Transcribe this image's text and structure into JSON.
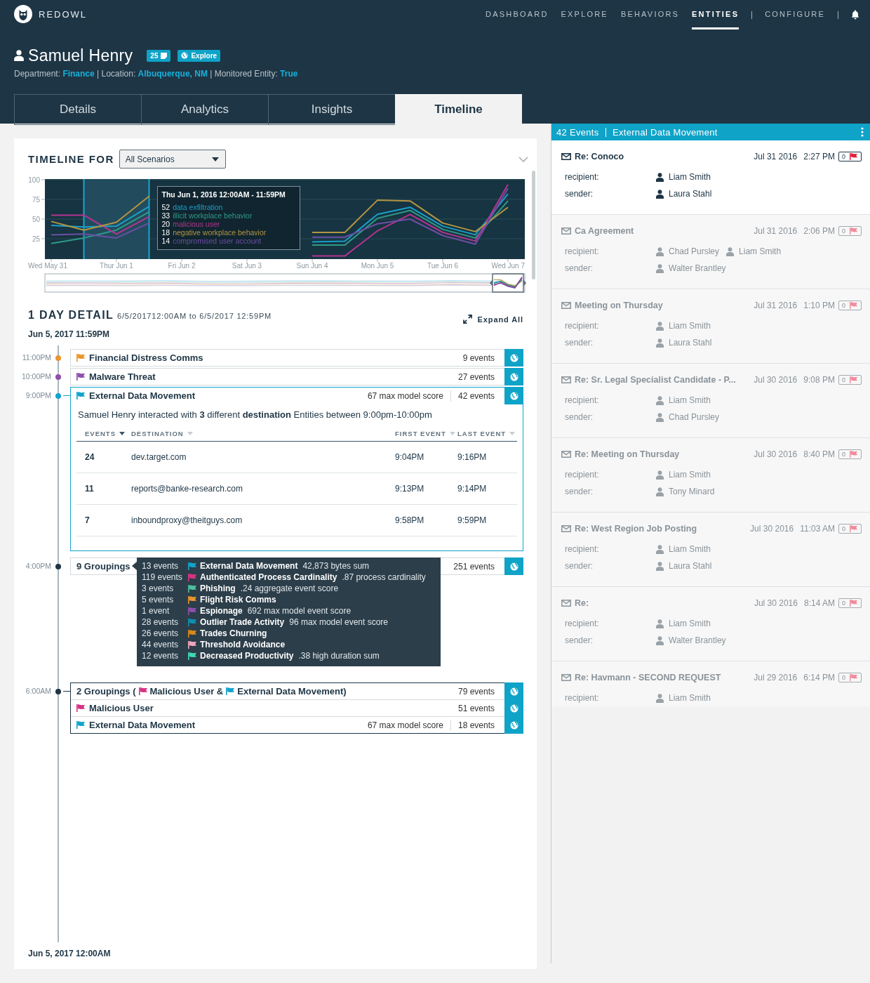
{
  "header": {
    "brand": "REDOWL",
    "nav_groups": [
      [
        {
          "label": "DASHBOARD",
          "selected": false
        },
        {
          "label": "EXPLORE",
          "selected": false
        },
        {
          "label": "BEHAVIORS",
          "selected": false
        },
        {
          "label": "ENTITIES",
          "selected": true
        }
      ],
      [
        {
          "label": "CONFIGURE",
          "selected": false
        }
      ]
    ]
  },
  "entity": {
    "name": "Samuel Henry",
    "notes_count": "25",
    "explore_label": "Explore",
    "meta": "Department: **Finance** | Location: **Albuquerque, NM** | Monitored Entity: **True**"
  },
  "tabs": [
    {
      "label": "Details",
      "selected": false
    },
    {
      "label": "Analytics",
      "selected": false
    },
    {
      "label": "Insights",
      "selected": false
    },
    {
      "label": "Timeline",
      "selected": true
    }
  ],
  "timeline": {
    "title": "TIMELINE FOR",
    "scenario": "All Scenarios",
    "days": [
      {
        "selected": false
      },
      {
        "selected": true
      },
      {
        "selected": false
      },
      {
        "selected": false
      },
      {
        "selected": false
      },
      {
        "selected": false
      },
      {
        "selected": false
      },
      {
        "selected": false
      }
    ],
    "chart_data": {
      "type": "line",
      "grid": true,
      "categories": [
        "Wed May 31",
        null,
        "Thur Jun 1",
        null,
        "Fri Jun 2",
        null,
        "Sat Jun 3",
        null,
        "Sun Jun 4",
        null,
        "Mon Jun 5",
        null,
        "Tue Jun 6",
        null,
        "Wed Jun 7"
      ],
      "ylim": [
        0,
        100
      ],
      "yticks": [
        25,
        50,
        75,
        100
      ],
      "series": [
        {
          "name": "data exfiltration",
          "color": "#1a9fca",
          "values": [
            42,
            40,
            41,
            66,
            null,
            null,
            null,
            null,
            21,
            22,
            56,
            65,
            41,
            30,
            82
          ]
        },
        {
          "name": "illicit workplace behavior",
          "color": "#2f9a8a",
          "values": [
            19,
            26,
            36,
            59,
            null,
            null,
            null,
            null,
            17,
            17,
            51,
            61,
            37,
            26,
            73
          ]
        },
        {
          "name": "malicious user",
          "color": "#b3348f",
          "values": [
            55,
            55,
            31,
            53,
            null,
            null,
            null,
            null,
            3,
            3,
            35,
            56,
            33,
            22,
            94
          ]
        },
        {
          "name": "negative workplace behavior",
          "color": "#b39543",
          "values": [
            47,
            36,
            46,
            79,
            null,
            null,
            null,
            null,
            33,
            33,
            74,
            73,
            45,
            34,
            65
          ]
        },
        {
          "name": "compromised user account",
          "color": "#6c4ea3",
          "values": [
            30,
            31,
            26,
            45,
            null,
            null,
            null,
            null,
            27,
            27,
            44,
            50,
            29,
            18,
            89
          ]
        }
      ]
    },
    "tooltip": {
      "title": "Thu Jun 1, 2016 12:00AM - 11:59PM",
      "values": [
        "52",
        "33",
        "20",
        "18",
        "14"
      ]
    }
  },
  "day_detail": {
    "title": "1 DAY DETAIL",
    "range": "6/5/201712:00AM to 6/5/2017 12:59PM",
    "expand_label": "Expand All",
    "start": "Jun 5, 2017 11:59PM",
    "end": "Jun 5, 2017 12:00AM",
    "entries": [
      {
        "kind": "scenario",
        "time": "11:00PM",
        "color": "#e8962e",
        "name": "Financial Distress Comms",
        "events": "9 events",
        "expanded": false
      },
      {
        "kind": "scenario",
        "time": "10:00PM",
        "color": "#8e4fae",
        "name": "Malware Threat",
        "events": "27 events",
        "expanded": false
      },
      {
        "kind": "scenario",
        "time": "9:00PM",
        "color": "#12a3cc",
        "name": "External Data Movement",
        "score": "67 max model score",
        "events": "42 events",
        "expanded": true,
        "detail": {
          "summary": "Samuel Henry interacted with **3** different **destination** Entities between 9:00pm-10:00pm",
          "columns": [
            {
              "label": "EVENTS",
              "sorted": true
            },
            {
              "label": "DESTINATION",
              "sorted": false
            },
            {
              "label": "FIRST EVENT",
              "sorted": false
            },
            {
              "label": "LAST EVENT",
              "sorted": false
            }
          ],
          "rows": [
            [
              "24",
              "dev.target.com",
              "9:04PM",
              "9:16PM"
            ],
            [
              "11",
              "reports@banke-research.com",
              "9:13PM",
              "9:14PM"
            ],
            [
              "7",
              "inboundproxy@theitguys.com",
              "9:58PM",
              "9:59PM"
            ]
          ]
        }
      },
      {
        "kind": "groupings",
        "time": "4:00PM",
        "color": "#1e3545",
        "name": "9 Groupings",
        "events": "251 events",
        "expanded": false,
        "popover": [
          {
            "events": "13 events",
            "color": "#12a3cc",
            "name": "External Data Movement",
            "metric": "42,873 bytes sum"
          },
          {
            "events": "119 events",
            "color": "#d63384",
            "name": "Authenticated Process Cardinality",
            "metric": ".87 process cardinality"
          },
          {
            "events": "3 events",
            "color": "#4fbf9f",
            "name": "Phishing",
            "metric": ".24 aggregate event score"
          },
          {
            "events": "5 events",
            "color": "#e8962e",
            "name": "Flight Risk Comms"
          },
          {
            "events": "1 event",
            "color": "#8e4fae",
            "name": "Espionage",
            "metric": "692 max model event score"
          },
          {
            "events": "28 events",
            "color": "#0e8fae",
            "name": "Outlier Trade Activity",
            "metric": "96 max model event score"
          },
          {
            "events": "26 events",
            "color": "#d68a1c",
            "name": "Trades Churning"
          },
          {
            "events": "44 events",
            "color": "#f2a7bf",
            "name": "Threshold Avoidance"
          },
          {
            "events": "12 events",
            "color": "#3fd9b0",
            "name": "Decreased Productivity",
            "metric": ".38 high duration sum"
          }
        ]
      },
      {
        "kind": "group",
        "time": "6:00AM",
        "color": "#1e3545",
        "expanded": true,
        "heading": [
          {
            "text": "2 Groupings ("
          },
          {
            "text": "Malicious User &",
            "color": "#d63384"
          },
          {
            "text": "External Data Movement)",
            "color": "#12a3cc"
          }
        ],
        "events": "79 events",
        "children": [
          {
            "name": "Malicious User",
            "color": "#d63384",
            "events": "51 events"
          },
          {
            "name": "External Data Movement",
            "color": "#12a3cc",
            "score": "67 max model score",
            "events": "18 events"
          }
        ]
      }
    ]
  },
  "event_panel": {
    "count": "42 Events",
    "scenario": "External Data Movement",
    "items": [
      {
        "subject": "Re: Conoco",
        "date": "Jul 31 2016",
        "time": "2:27 PM",
        "flag_count": "0",
        "selected": true,
        "recipient_label": "recipient:",
        "recipients": [
          "Liam Smith"
        ],
        "sender_label": "sender:",
        "senders": [
          "Laura Stahl"
        ]
      },
      {
        "subject": "Ca Agreement",
        "date": "Jul 31 2016",
        "time": "2:06 PM",
        "flag_count": "0",
        "selected": false,
        "recipient_label": "recipient:",
        "recipients": [
          "Chad Pursley",
          "Liam Smith"
        ],
        "sender_label": "sender:",
        "senders": [
          "Walter Brantley"
        ]
      },
      {
        "subject": "Meeting on Thursday",
        "date": "Jul 31 2016",
        "time": "1:10 PM",
        "flag_count": "0",
        "selected": false,
        "recipient_label": "recipient:",
        "recipients": [
          "Liam Smith"
        ],
        "sender_label": "sender:",
        "senders": [
          "Laura Stahl"
        ]
      },
      {
        "subject": "Re: Sr. Legal Specialist Candidate - P...",
        "date": "Jul 30 2016",
        "time": "9:08 PM",
        "flag_count": "0",
        "selected": false,
        "recipient_label": "recipient:",
        "recipients": [
          "Liam Smith"
        ],
        "sender_label": "sender:",
        "senders": [
          "Chad Pursley"
        ]
      },
      {
        "subject": "Re: Meeting on Thursday",
        "date": "Jul 30 2016",
        "time": "8:40 PM",
        "flag_count": "0",
        "selected": false,
        "recipient_label": "recipient:",
        "recipients": [
          "Liam Smith"
        ],
        "sender_label": "sender:",
        "senders": [
          "Tony Minard"
        ]
      },
      {
        "subject": "Re: West Region Job Posting",
        "date": "Jul 30 2016",
        "time": "11:03 AM",
        "flag_count": "0",
        "selected": false,
        "recipient_label": "recipient:",
        "recipients": [
          "Liam Smith"
        ],
        "sender_label": "sender:",
        "senders": [
          "Laura Stahl"
        ]
      },
      {
        "subject": "Re:",
        "date": "Jul 30 2016",
        "time": "8:14 AM",
        "flag_count": "0",
        "selected": false,
        "recipient_label": "recipient:",
        "recipients": [
          "Liam Smith"
        ],
        "sender_label": "sender:",
        "senders": [
          "Walter Brantley"
        ]
      },
      {
        "subject": "Re: Havmann - SECOND REQUEST",
        "date": "Jul 29 2016",
        "time": "6:14 PM",
        "flag_count": "0",
        "selected": false,
        "recipient_label": "recipient:",
        "recipients": [
          "Liam Smith"
        ]
      }
    ]
  }
}
